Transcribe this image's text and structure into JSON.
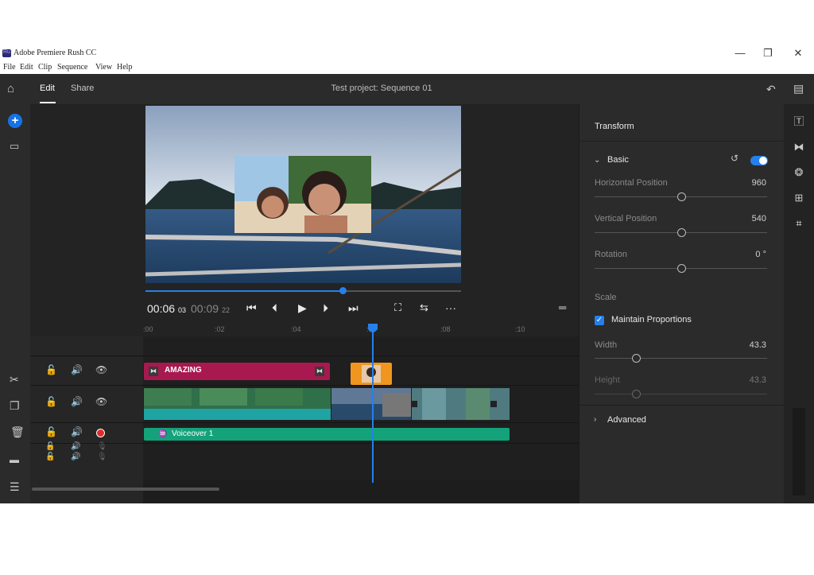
{
  "window": {
    "title": "Adobe Premiere Rush CC",
    "minimize": "—",
    "maximize": "❐",
    "close": "✕"
  },
  "menu": [
    "File",
    "Edit",
    "Clip",
    "Sequence",
    "View",
    "Help"
  ],
  "topbar": {
    "tabs": [
      {
        "label": "Edit",
        "active": true
      },
      {
        "label": "Share",
        "active": false
      }
    ],
    "project_title": "Test project: Sequence 01"
  },
  "player": {
    "current_time": "00:06",
    "current_frames": "03",
    "total_time": "00:09",
    "total_frames": "22",
    "scrub_progress": 0.625
  },
  "timeline": {
    "ruler_ticks": [
      ":00",
      ":02",
      ":04",
      ":06",
      ":08",
      ":10"
    ],
    "title_clip": "AMAZING",
    "audio_clip": "Voiceover 1",
    "playhead_time": "00:06:03"
  },
  "panel": {
    "title": "Transform",
    "basic_section": "Basic",
    "properties": [
      {
        "label": "Horizontal Position",
        "value": "960",
        "level": 0.5
      },
      {
        "label": "Vertical Position",
        "value": "540",
        "level": 0.5
      },
      {
        "label": "Rotation",
        "value": "0 °",
        "level": 0.5
      }
    ],
    "scale_label": "Scale",
    "maintain_proportions": "Maintain Proportions",
    "scale_properties": [
      {
        "label": "Width",
        "value": "43.3",
        "level": 0.24
      },
      {
        "label": "Height",
        "value": "43.3",
        "level": 0.24
      }
    ],
    "advanced_section": "Advanced"
  },
  "colors": {
    "accent": "#2680eb",
    "title_clip": "#a8194f",
    "audio_clip": "#14a27a",
    "orange_clip": "#f0961e"
  }
}
